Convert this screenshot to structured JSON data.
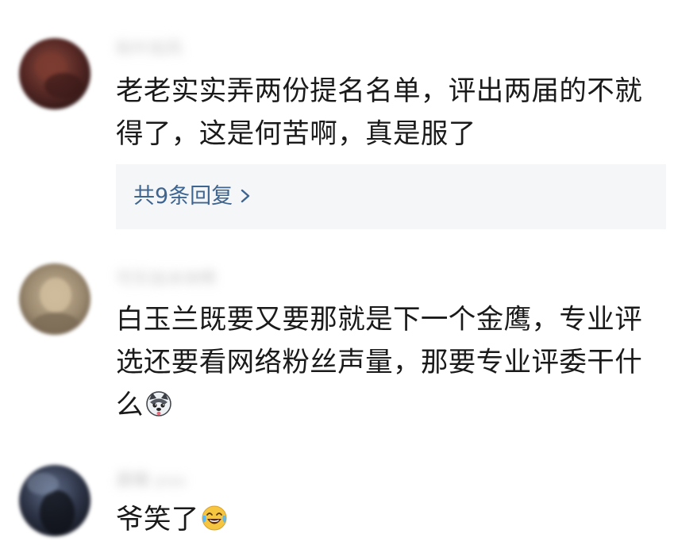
{
  "comments": [
    {
      "username": "秋叶如风",
      "text": "老老实实弄两份提名名单，评出两届的不就得了，这是何苦啊，真是服了",
      "reply_link": "共9条回复",
      "avatar_icon": "user-avatar-dark-red",
      "accent": "#3e6590"
    },
    {
      "username": "可乐加冰块啊",
      "text": "白玉兰既要又要那就是下一个金鹰，专业评选还要看网络粉丝声量，那要专业评委干什么",
      "emoji_icon": "husky-emoji-icon"
    },
    {
      "username": "晨曦 yuu",
      "text": "爷笑了",
      "emoji_icon": "tears-of-joy-emoji-icon"
    }
  ]
}
